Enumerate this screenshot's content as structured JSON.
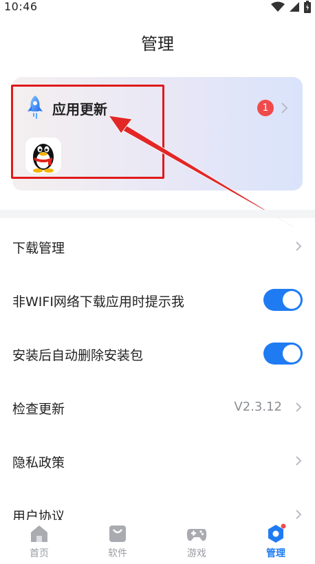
{
  "status_bar": {
    "time": "10:46"
  },
  "header": {
    "title": "管理"
  },
  "update_card": {
    "title": "应用更新",
    "badge_count": "1",
    "apps": [
      "qq"
    ]
  },
  "settings": [
    {
      "label": "下载管理",
      "type": "link"
    },
    {
      "label": "非WIFI网络下载应用时提示我",
      "type": "toggle",
      "on": true
    },
    {
      "label": "安装后自动删除安装包",
      "type": "toggle",
      "on": true
    },
    {
      "label": "检查更新",
      "type": "link",
      "value": "V2.3.12"
    },
    {
      "label": "隐私政策",
      "type": "link"
    },
    {
      "label": "用户协议",
      "type": "link"
    }
  ],
  "bottom_nav": [
    {
      "label": "首页",
      "icon": "home-icon",
      "active": false
    },
    {
      "label": "软件",
      "icon": "bag-icon",
      "active": false
    },
    {
      "label": "游戏",
      "icon": "gamepad-icon",
      "active": false
    },
    {
      "label": "管理",
      "icon": "manage-hexagon-icon",
      "active": true
    }
  ],
  "colors": {
    "accent": "#1f7bf2",
    "badge": "#f04a4a",
    "annotation": "#e01919",
    "nav_inactive": "#9a9ca1"
  }
}
